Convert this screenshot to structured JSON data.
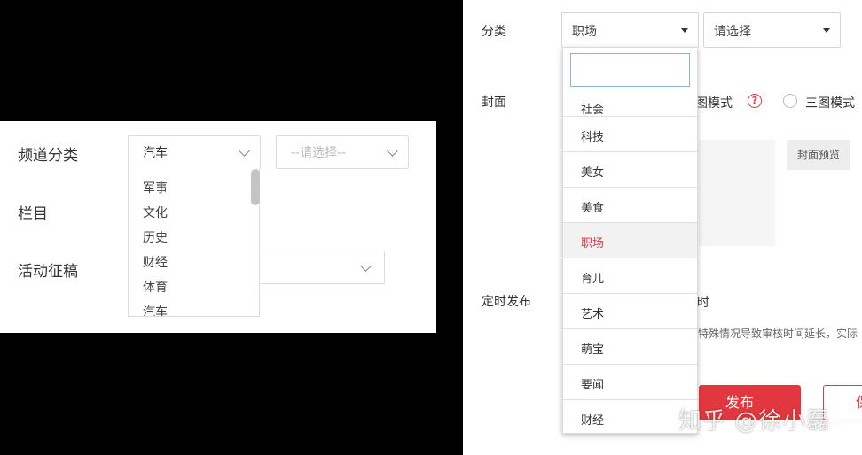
{
  "left": {
    "labels": {
      "channel_category": "频道分类",
      "column": "栏目",
      "activity": "活动征稿"
    },
    "select1": {
      "value": "汽车"
    },
    "select2": {
      "placeholder": "--请选择--"
    },
    "options": [
      "军事",
      "文化",
      "历史",
      "财经",
      "体育",
      "汽车"
    ]
  },
  "right": {
    "labels": {
      "category": "分类",
      "cover": "封面",
      "scheduled": "定时发布"
    },
    "select1": {
      "value": "职场"
    },
    "select2": {
      "value": "请选择"
    },
    "dropdown_items": [
      "社会",
      "科技",
      "美女",
      "美食",
      "职场",
      "育儿",
      "艺术",
      "萌宝",
      "要闻",
      "财经"
    ],
    "selected_item": "职场",
    "cover_modes": {
      "large": "大图模式",
      "three": "三图模式"
    },
    "help_mark": "?",
    "preview_button": "封面预览",
    "scheduled_text": "定时",
    "notice_text": "因特殊情况导致审核时间延长，实际",
    "publish_button": "发布",
    "save_button": "保",
    "accent": "#e3373f"
  },
  "watermark": "知乎 @徐小磊"
}
